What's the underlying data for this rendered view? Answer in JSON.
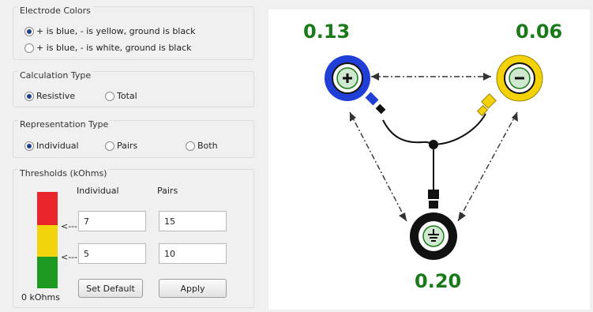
{
  "electrode_colors": {
    "title": "Electrode Colors",
    "options": [
      {
        "label": "+ is blue, - is yellow, ground is black",
        "selected": true
      },
      {
        "label": "+ is blue, - is white, ground is black",
        "selected": false
      }
    ]
  },
  "calculation_type": {
    "title": "Calculation Type",
    "options": [
      {
        "label": "Resistive",
        "selected": true
      },
      {
        "label": "Total",
        "selected": false
      }
    ]
  },
  "representation_type": {
    "title": "Representation Type",
    "options": [
      {
        "label": "Individual",
        "selected": true
      },
      {
        "label": "Pairs",
        "selected": false
      },
      {
        "label": "Both",
        "selected": false
      }
    ]
  },
  "thresholds": {
    "title": "Thresholds (kOhms)",
    "individual_header": "Individual",
    "pairs_header": "Pairs",
    "arrow_label": "<---",
    "individual_high": "7",
    "pairs_high": "15",
    "individual_low": "5",
    "pairs_low": "10",
    "zero_label": "0 kOhms",
    "set_default_label": "Set Default",
    "apply_label": "Apply",
    "colors": {
      "high": "#e8252a",
      "mid": "#f2d40c",
      "low": "#1d9a22"
    }
  },
  "diagram": {
    "positive_value": "0.13",
    "negative_value": "0.06",
    "ground_value": "0.20",
    "value_color": "#1a7a1a",
    "positive_color": "#1f3fd6",
    "negative_color": "#f4d20a",
    "ground_color": "#111111",
    "icons": {
      "positive": "plus-icon",
      "negative": "minus-icon",
      "ground": "ground-icon"
    }
  }
}
